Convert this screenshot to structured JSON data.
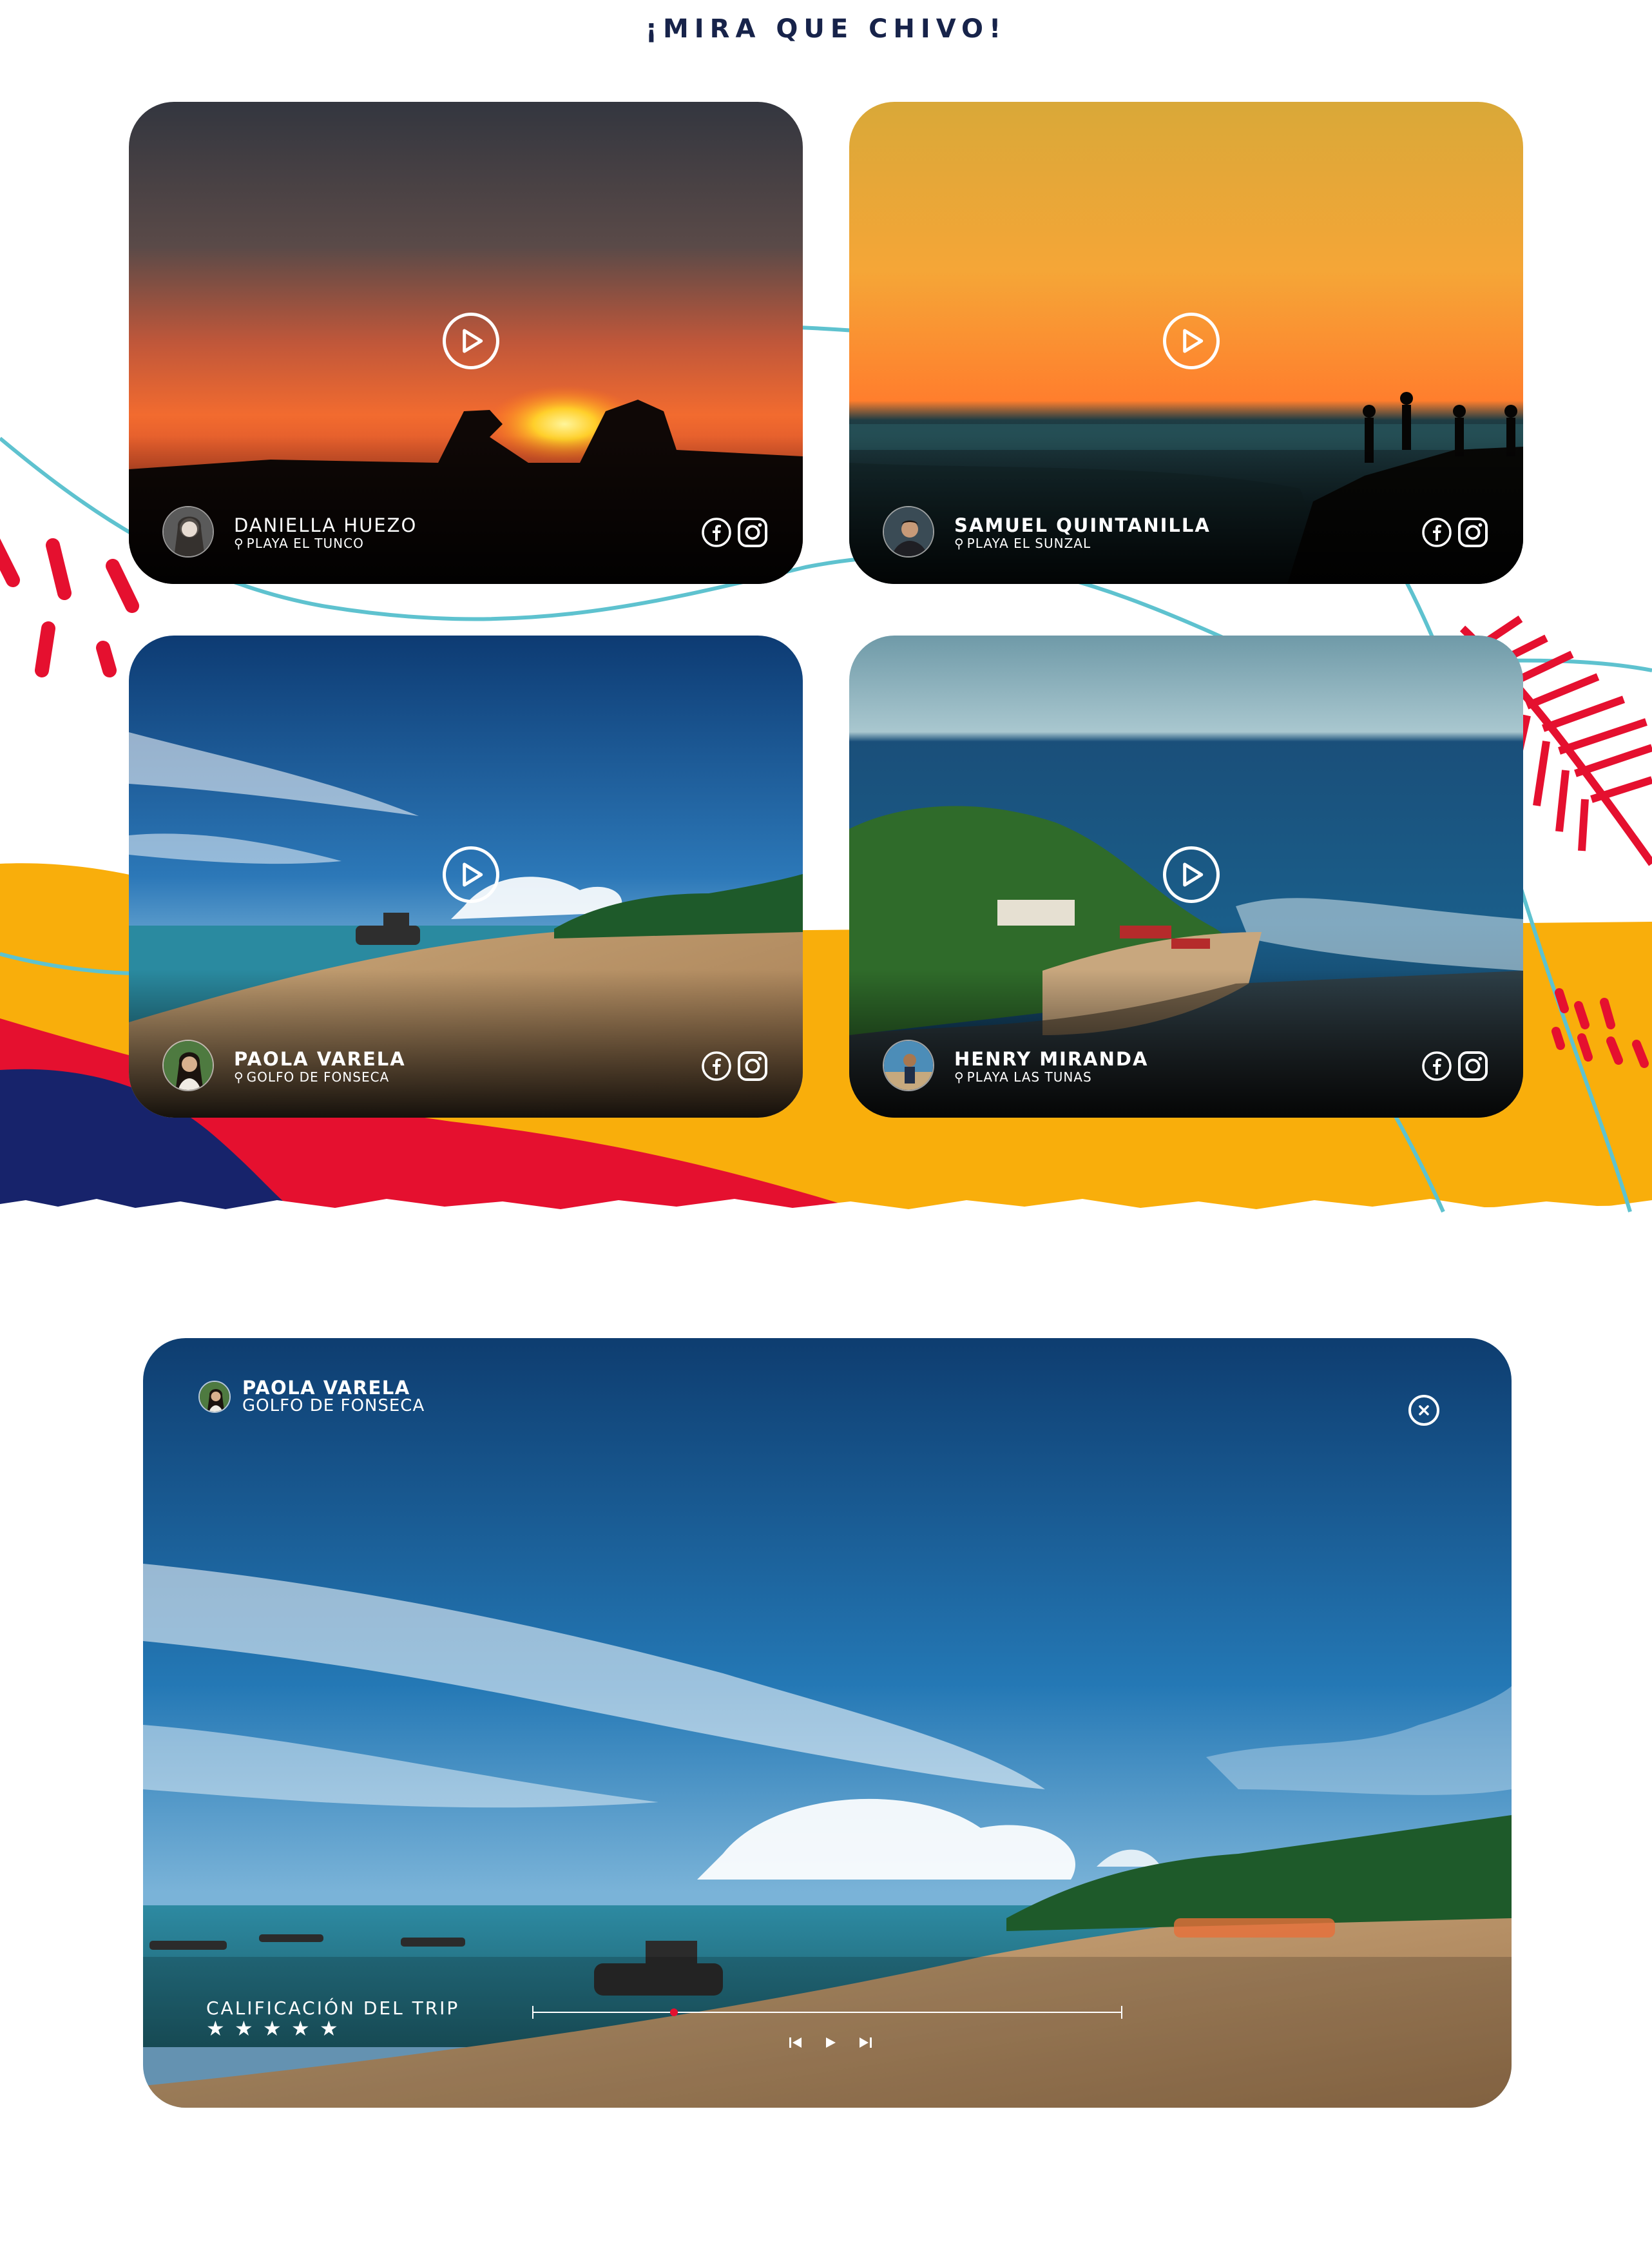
{
  "section": {
    "title": "¡MIRA QUE CHIVO!"
  },
  "cards": [
    {
      "name": "DANIELLA HUEZO",
      "location": "PLAYA EL TUNCO",
      "scene": "sunset-rocks"
    },
    {
      "name": "SAMUEL QUINTANILLA",
      "location": "PLAYA EL SUNZAL",
      "scene": "orange-sunset-cliff"
    },
    {
      "name": "PAOLA VARELA",
      "location": "GOLFO DE FONSECA",
      "scene": "tropical-beach"
    },
    {
      "name": "HENRY MIRANDA",
      "location": "PLAYA LAS TUNAS",
      "scene": "aerial-peninsula"
    }
  ],
  "icons": {
    "play": "play-circle-icon",
    "facebook": "facebook-icon",
    "instagram": "instagram-icon",
    "pin": "location-pin-icon",
    "close": "close-icon",
    "prev": "skip-previous-icon",
    "play_ctrl": "play-icon",
    "next": "skip-next-icon"
  },
  "modal": {
    "name": "PAOLA VARELA",
    "location": "GOLFO DE FONSECA",
    "rating_label": "CALIFICACIÓN DEL TRIP",
    "rating": 5,
    "stars": [
      "★",
      "★",
      "★",
      "★",
      "★"
    ],
    "progress": 0.24
  },
  "colors": {
    "title": "#17234a",
    "accent_red": "#e5102f",
    "accent_yellow": "#f9ae0b",
    "accent_navy": "#17236b",
    "accent_cyan": "#5ec2cf"
  }
}
